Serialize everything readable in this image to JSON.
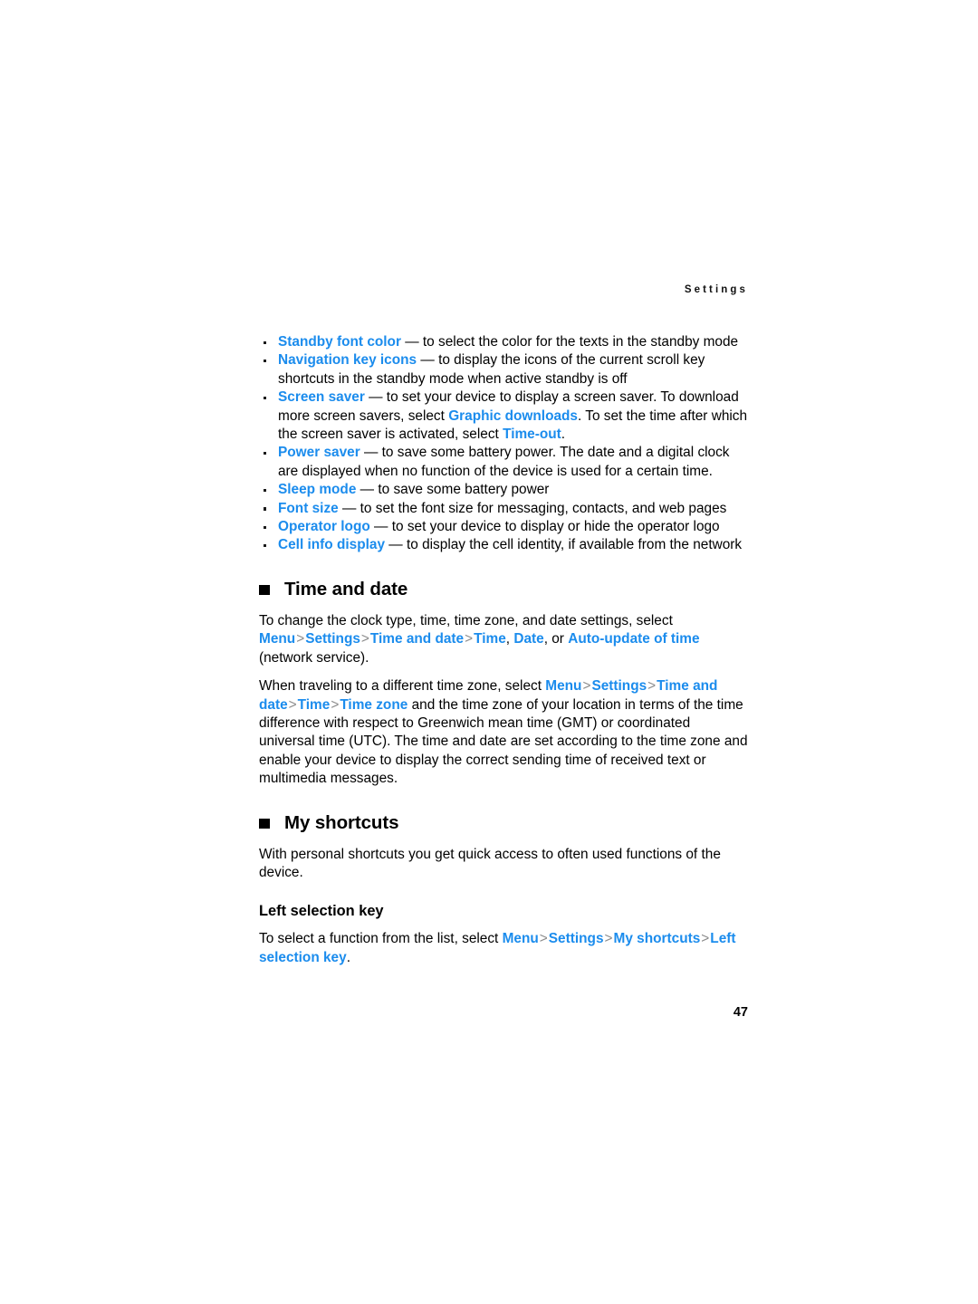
{
  "page": {
    "running_header": "Settings",
    "folio": "47",
    "link_color": "#1b8ced",
    "separator_color": "#8c8c8c",
    "text_color": "#000000",
    "background_color": "#ffffff"
  },
  "bullets": [
    {
      "term": "Standby font color",
      "dash": "—",
      "description": "to select the color for the texts in the standby mode"
    },
    {
      "term": "Navigation key icons",
      "dash": "—",
      "description": "to display the icons of the current scroll key shortcuts in the standby mode when active standby is off"
    },
    {
      "term": "Screen saver",
      "dash": "—",
      "description_part1": "to set your device to display a screen saver. To download more screen savers, select ",
      "inline_term1": "Graphic downloads",
      "description_part2": ". To set the time after which the screen saver is activated, select ",
      "inline_term2": "Time-out",
      "description_part3": "."
    },
    {
      "term": "Power saver",
      "dash": "—",
      "description": "to save some battery power. The date and a digital clock are displayed when no function of the device is used for a certain time."
    },
    {
      "term": "Sleep mode",
      "dash": "—",
      "description": "to save some battery power"
    },
    {
      "term": "Font size",
      "dash": "—",
      "description": "to set the font size for messaging, contacts, and web pages"
    },
    {
      "term": "Operator logo",
      "dash": "—",
      "description": "to set your device to display or hide the operator logo"
    },
    {
      "term": "Cell info display",
      "dash": "—",
      "description": "to display the cell identity, if available from the network"
    }
  ],
  "time_and_date": {
    "heading": "Time and date",
    "para1": {
      "lead": "To change the clock type, time, time zone, and date settings, select ",
      "path": [
        "Menu",
        "Settings",
        "Time and date"
      ],
      "separator": ">",
      "options_lead": "",
      "option1": "Time",
      "comma1": ", ",
      "option2": "Date",
      "conjunction": ", or ",
      "option3": "Auto-update of time",
      "tail": " (network service)."
    },
    "para2": {
      "lead": "When traveling to a different time zone, select ",
      "path": [
        "Menu",
        "Settings",
        "Time and date",
        "Time",
        "Time zone"
      ],
      "separator": ">",
      "tail": " and the time zone of your location in terms of the time difference with respect to Greenwich mean time (GMT) or coordinated universal time (UTC). The time and date are set according to the time zone and enable your device to display the correct sending time of received text or multimedia messages."
    }
  },
  "my_shortcuts": {
    "heading": "My shortcuts",
    "intro": "With personal shortcuts you get quick access to often used functions of the device.",
    "subheading": "Left selection key",
    "para": {
      "lead": "To select a function from the list, select ",
      "path": [
        "Menu",
        "Settings",
        "My shortcuts",
        "Left selection key"
      ],
      "separator": ">",
      "tail": "."
    }
  }
}
